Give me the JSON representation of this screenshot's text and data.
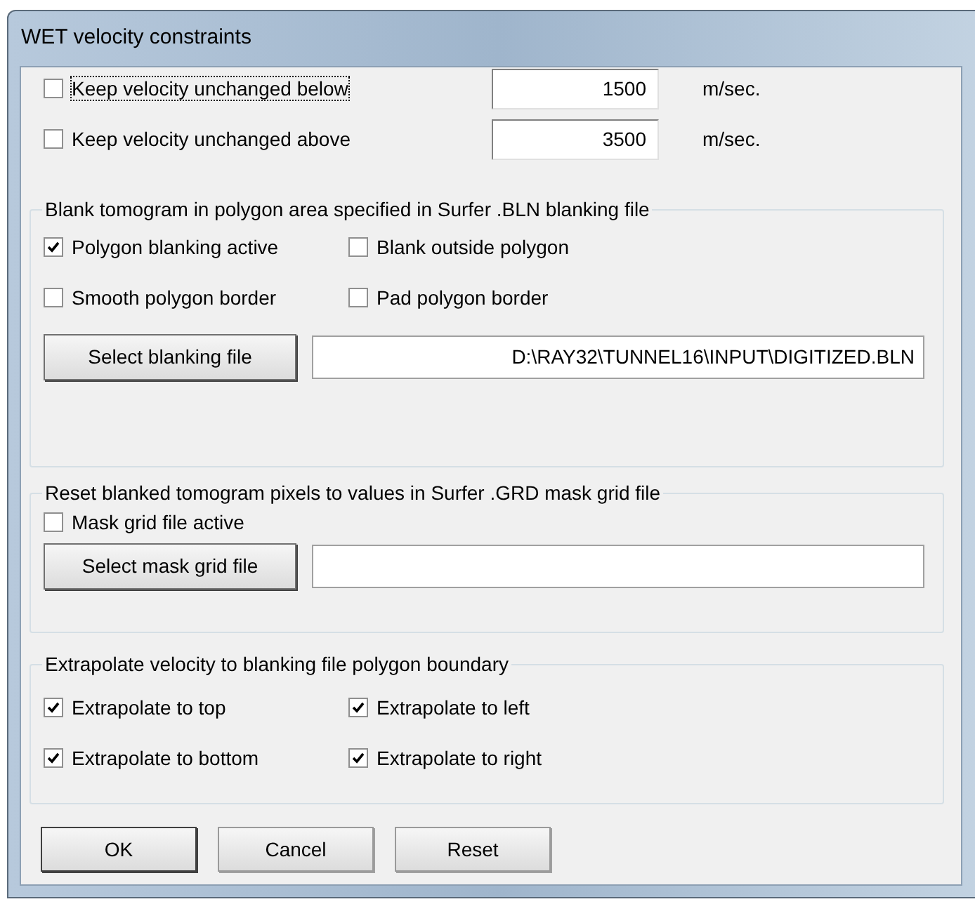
{
  "window": {
    "title": "WET velocity constraints"
  },
  "limits": [
    {
      "label": "Keep velocity unchanged below",
      "checked": false,
      "focused": true,
      "value": "1500",
      "unit": "m/sec."
    },
    {
      "label": "Keep velocity unchanged above",
      "checked": false,
      "focused": false,
      "value": "3500",
      "unit": "m/sec."
    }
  ],
  "blanking": {
    "title": "Blank tomogram in polygon area specified in Surfer .BLN blanking file",
    "options": [
      {
        "label": "Polygon blanking active",
        "checked": true
      },
      {
        "label": "Blank outside polygon",
        "checked": false
      },
      {
        "label": "Smooth polygon border",
        "checked": false
      },
      {
        "label": "Pad polygon border",
        "checked": false
      }
    ],
    "button": "Select blanking file",
    "file": "D:\\RAY32\\TUNNEL16\\INPUT\\DIGITIZED.BLN"
  },
  "mask": {
    "title": "Reset blanked tomogram pixels to values in Surfer .GRD mask grid file",
    "options": [
      {
        "label": "Mask grid file active",
        "checked": false
      }
    ],
    "button": "Select mask grid file"
  },
  "extrapolate": {
    "title": "Extrapolate velocity to blanking file polygon boundary",
    "options": [
      {
        "label": "Extrapolate to top",
        "checked": true
      },
      {
        "label": "Extrapolate to left",
        "checked": true
      },
      {
        "label": "Extrapolate to bottom",
        "checked": true
      },
      {
        "label": "Extrapolate to right",
        "checked": true
      }
    ]
  },
  "buttons": [
    {
      "label": "OK",
      "default": true
    },
    {
      "label": "Cancel",
      "default": false
    },
    {
      "label": "Reset",
      "default": false
    }
  ]
}
